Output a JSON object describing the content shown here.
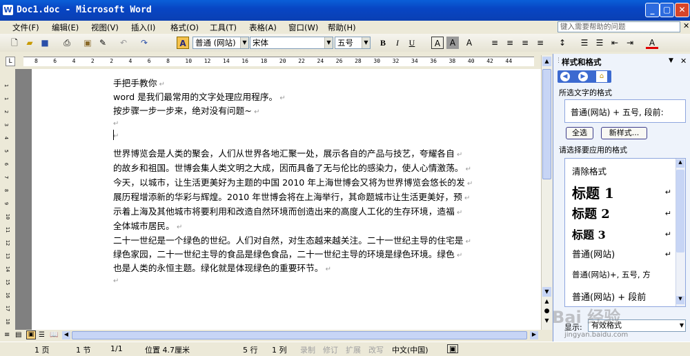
{
  "window": {
    "title": "Doc1.doc - Microsoft Word"
  },
  "menu": [
    "文件(F)",
    "编辑(E)",
    "视图(V)",
    "插入(I)",
    "格式(O)",
    "工具(T)",
    "表格(A)",
    "窗口(W)",
    "帮助(H)"
  ],
  "help_placeholder": "键入需要帮助的问题",
  "toolbar": {
    "style": "普通 (网站)",
    "font": "宋体",
    "size": "五号",
    "bold": "B",
    "italic": "I",
    "underline": "U",
    "fontcolor": "A",
    "charborder": "A",
    "charshade": "A",
    "phonetic": "A"
  },
  "ruler": [
    "8",
    "6",
    "4",
    "2",
    "2",
    "4",
    "6",
    "8",
    "10",
    "12",
    "14",
    "16",
    "18",
    "20",
    "22",
    "24",
    "26",
    "28",
    "30",
    "32",
    "34",
    "36",
    "38",
    "40",
    "42",
    "44"
  ],
  "vruler": [
    "1",
    "1",
    "2",
    "3",
    "4",
    "5",
    "6",
    "7",
    "8",
    "9",
    "10",
    "11",
    "12",
    "13",
    "14",
    "15",
    "16",
    "17",
    "18",
    "19"
  ],
  "doc": {
    "lines": [
      "手把手教你",
      "word 是我们最常用的文字处理应用程序。",
      "按步骤一步一步来，绝对没有问题~",
      "",
      "",
      "世界博览会是人类的聚会，人们从世界各地汇聚一处，展示各自的产品与技艺，夸耀各自",
      "的故乡和祖国。世博会集人类文明之大成，因而具备了无与伦比的感染力，使人心情激荡。",
      "今天，以城市，让生活更美好为主题的中国 2010 年上海世博会又将为世界博览会悠长的发",
      "展历程增添新的华彩与辉煌。2010 年世博会将在上海举行，其命题城市让生活更美好，预",
      "示着上海及其他城市将要利用和改造自然环境而创造出来的高度人工化的生存环境，造福",
      "全体城市居民。",
      "二十一世纪是一个绿色的世纪。人们对自然，对生态越来越关注。二十一世纪主导的住宅是",
      "绿色家园，二十一世纪主导的食品是绿色食品，二十一世纪主导的环境是绿色环境。绿色",
      "也是人类的永恒主题。绿化就是体现绿色的重要环节。",
      ""
    ]
  },
  "status": {
    "page": "1 页",
    "section": "1 节",
    "pages": "1/1",
    "position": "位置 4.7厘米",
    "row": "5 行",
    "col": "1 列",
    "rec": "录制",
    "trk": "修订",
    "ext": "扩展",
    "ovr": "改写",
    "lang": "中文(中国)"
  },
  "pane": {
    "title": "样式和格式",
    "selected_label": "所选文字的格式",
    "selected_value": "普通(网站) + 五号, 段前:",
    "select_all": "全选",
    "new_style": "新样式...",
    "apply_label": "请选择要应用的格式",
    "styles": [
      "清除格式",
      "标题 1",
      "标题 2",
      "标题 3",
      "普通(网站)",
      "普通(网站)+, 五号, 方",
      "普通(网站) + 段前"
    ],
    "show_label": "显示:",
    "show_value": "有效格式"
  },
  "watermark": {
    "text": "Bai 经验",
    "url": "jingyan.baidu.com"
  }
}
